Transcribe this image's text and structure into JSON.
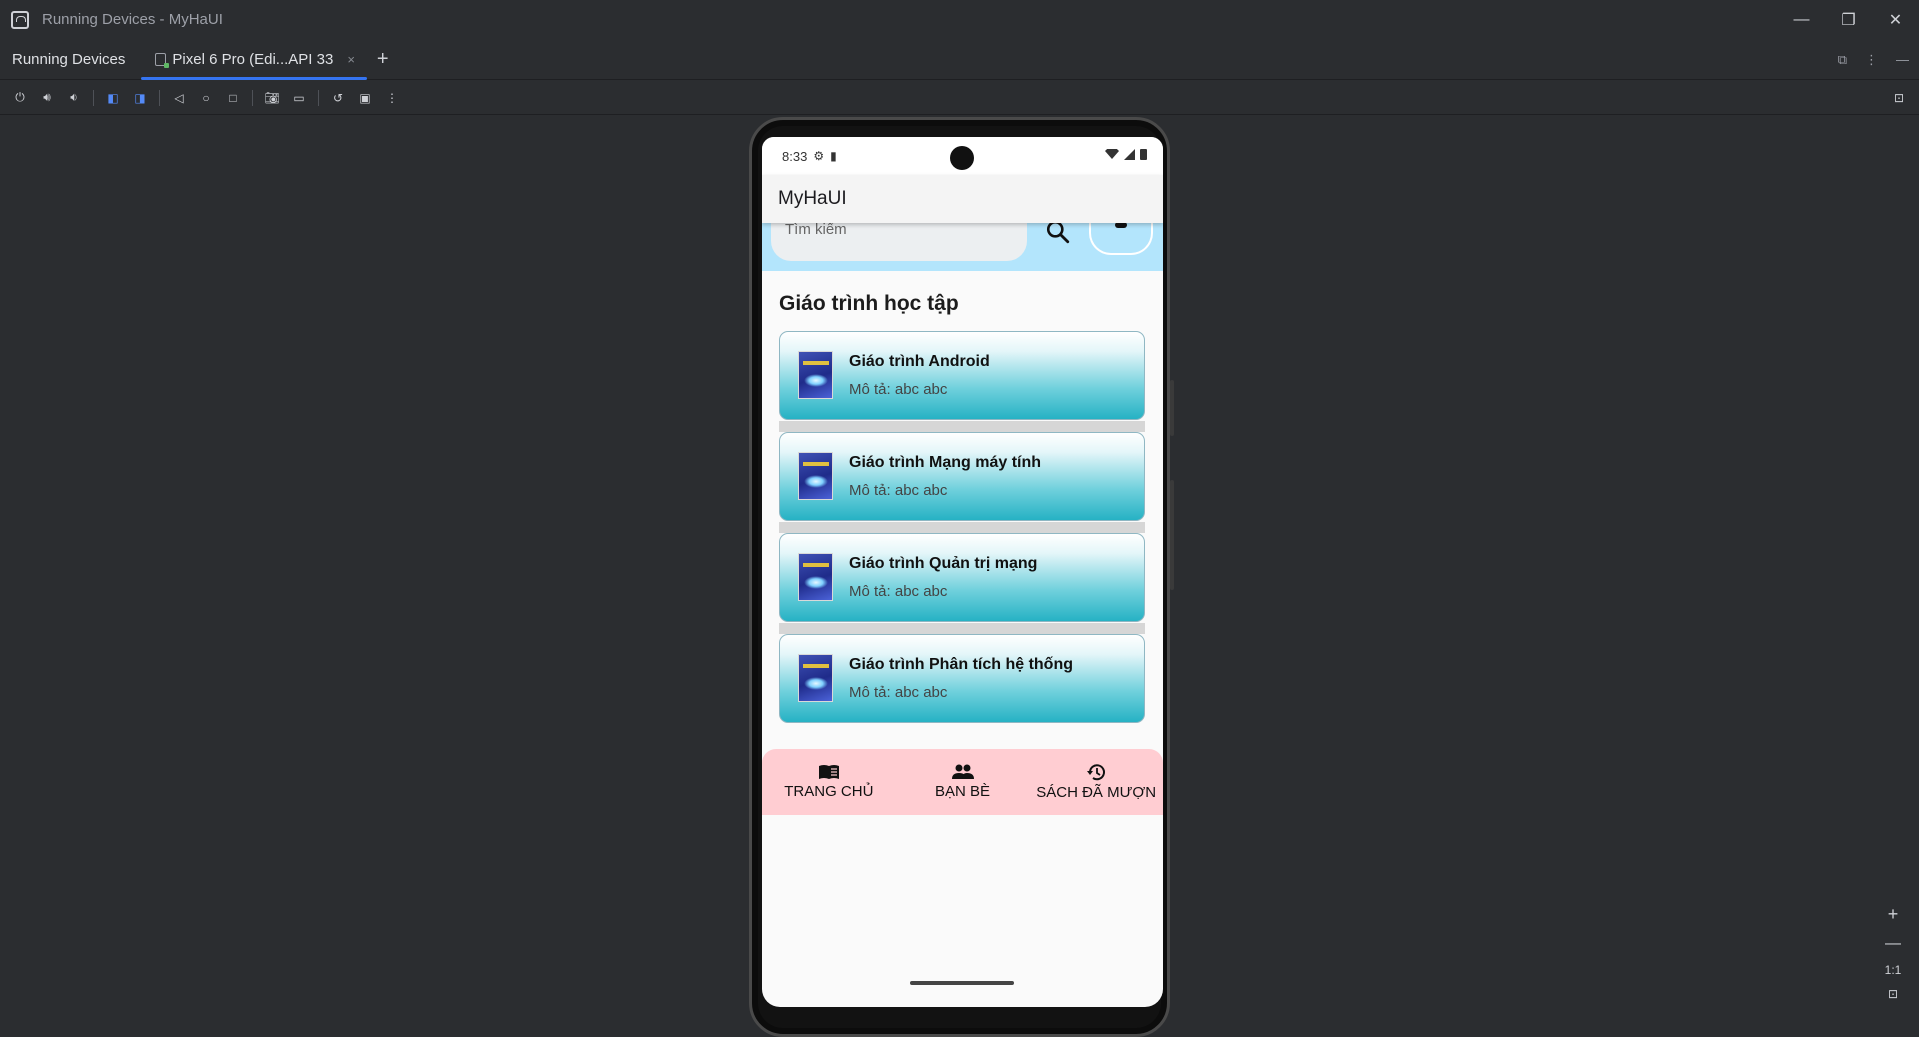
{
  "window": {
    "title": "Running Devices - MyHaUI",
    "app_icon": "android-studio-icon",
    "controls": [
      "minimize-icon",
      "restore-icon",
      "close-icon"
    ]
  },
  "tabbar": {
    "tool_title": "Running Devices",
    "tabs": [
      {
        "label": "Pixel 6 Pro (Edi...API 33",
        "close": "×"
      }
    ],
    "add": "+"
  },
  "device": {
    "status_time": "8:33",
    "app_title": "MyHaUI",
    "search_placeholder": "Tìm kiếm"
  },
  "main": {
    "section_title": "Giáo trình học tập",
    "books": [
      {
        "title": "Giáo trình Android",
        "desc": "Mô tả: abc abc"
      },
      {
        "title": "Giáo trình Mạng máy tính",
        "desc": "Mô tả: abc abc"
      },
      {
        "title": "Giáo trình Quản trị mạng",
        "desc": "Mô tả: abc abc"
      },
      {
        "title": "Giáo trình Phân tích hệ thống",
        "desc": "Mô tả: abc abc"
      }
    ]
  },
  "bottom_nav": {
    "items": [
      {
        "label": "TRANG CHỦ",
        "icon": "book-icon"
      },
      {
        "label": "BẠN BÈ",
        "icon": "people-icon"
      },
      {
        "label": "SÁCH ĐÃ MƯỢN",
        "icon": "history-icon"
      }
    ]
  },
  "zoom": {
    "one_to_one": "1:1"
  },
  "colors": {
    "tab_accent": "#3574f0",
    "search_band": "#b3e5fc",
    "bottom_nav": "#ffcdd2",
    "card_end": "#26b2c4"
  }
}
